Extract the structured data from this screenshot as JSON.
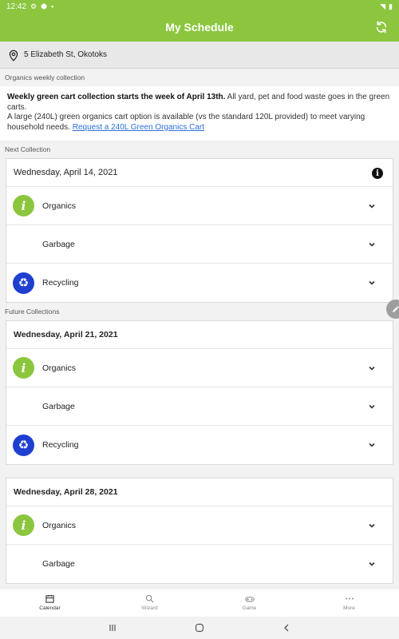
{
  "status_bar": {
    "time": "12:42"
  },
  "header": {
    "title": "My Schedule"
  },
  "address": {
    "text": "5 Elizabeth St, Okotoks"
  },
  "notice": {
    "section_label": "Organics weekly collection",
    "bold_text": "Weekly green cart collection starts the week of April 13th.",
    "text_1": " All yard, pet and food waste goes in the green carts.",
    "text_2": "A large (240L) green organics cart option is available (vs the standard 120L provided) to meet varying household needs. ",
    "link_text": "Request a 240L Green Organics Cart"
  },
  "next_collection": {
    "section_label": "Next Collection",
    "date": "Wednesday, April 14, 2021",
    "items": [
      {
        "label": "Organics",
        "type": "organics"
      },
      {
        "label": "Garbage",
        "type": "garbage"
      },
      {
        "label": "Recycling",
        "type": "recycling"
      }
    ]
  },
  "future_collections": {
    "section_label": "Future Collections",
    "cards": [
      {
        "date": "Wednesday, April 21, 2021",
        "items": [
          {
            "label": "Organics",
            "type": "organics"
          },
          {
            "label": "Garbage",
            "type": "garbage"
          },
          {
            "label": "Recycling",
            "type": "recycling"
          }
        ]
      },
      {
        "date": "Wednesday, April 28, 2021",
        "items": [
          {
            "label": "Organics",
            "type": "organics"
          },
          {
            "label": "Garbage",
            "type": "garbage"
          }
        ]
      }
    ]
  },
  "bottom_nav": [
    {
      "label": "Calendar",
      "icon": "calendar-icon",
      "active": true
    },
    {
      "label": "Wizard",
      "icon": "search-icon",
      "active": false
    },
    {
      "label": "Game",
      "icon": "game-icon",
      "active": false
    },
    {
      "label": "More",
      "icon": "more-icon",
      "active": false
    }
  ],
  "colors": {
    "brand_green": "#8cc63f",
    "recycling_blue": "#1f3fd1"
  }
}
